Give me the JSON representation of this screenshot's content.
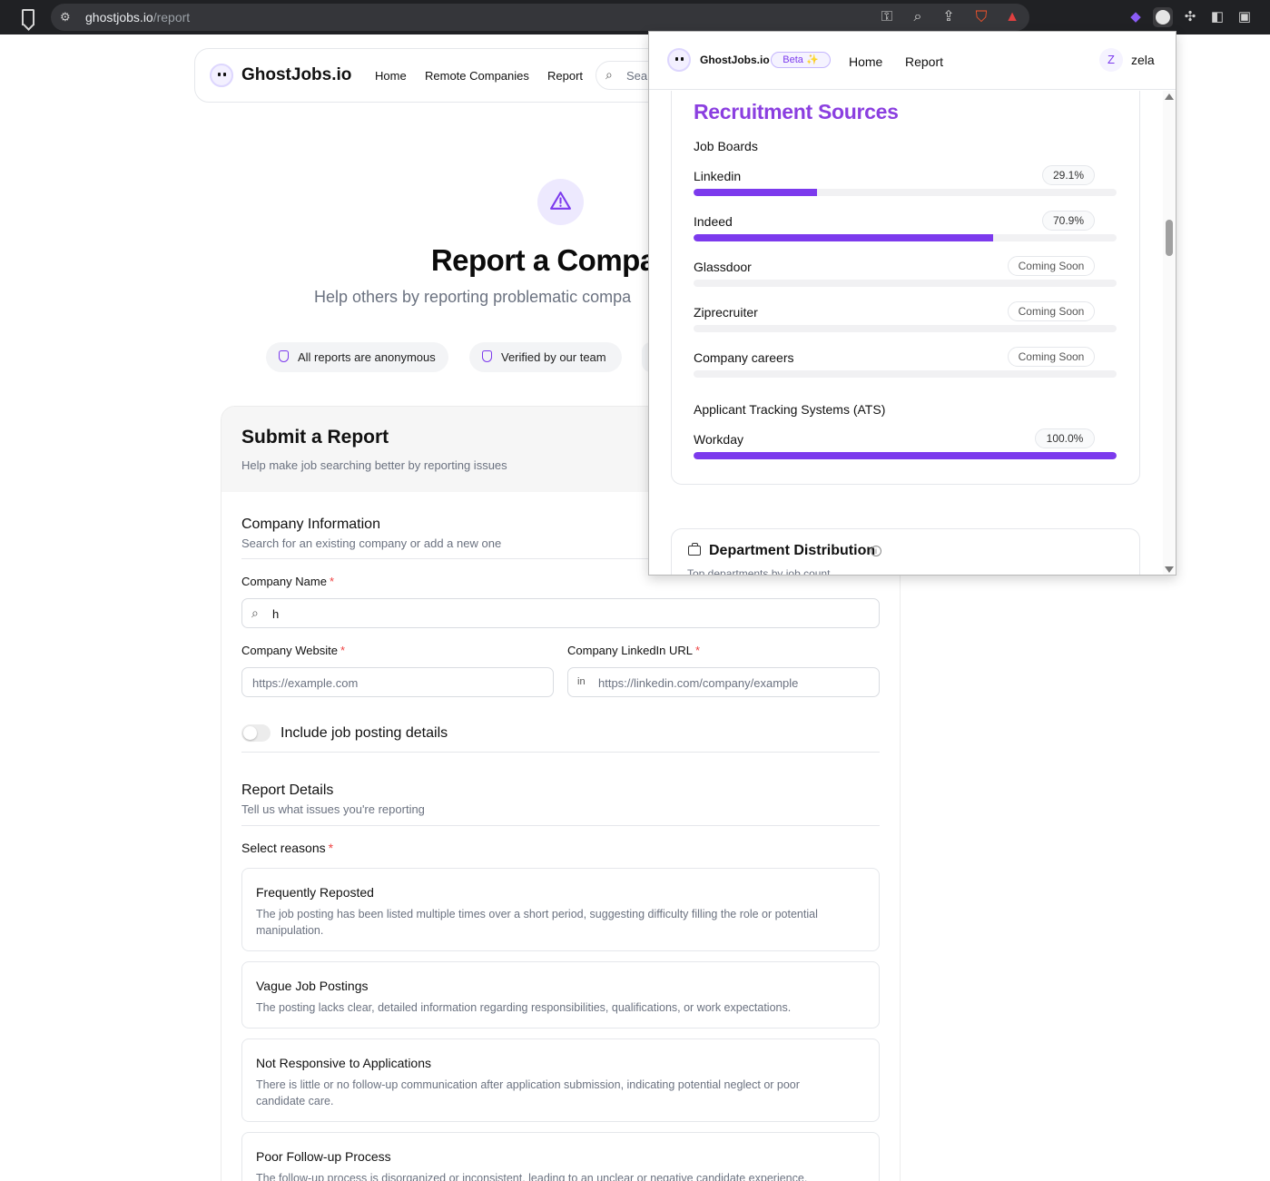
{
  "browser": {
    "url_host": "ghostjobs.io",
    "url_path": "/report",
    "icons": [
      "bookmark-icon",
      "site-settings-icon",
      "password-key-icon",
      "zoom-icon",
      "share-icon",
      "brave-shields-icon",
      "brave-rewards-icon",
      "extension-purple-icon",
      "ghostjobs-extension-icon",
      "extensions-puzzle-icon",
      "sidebar-icon",
      "wallet-icon"
    ]
  },
  "nav": {
    "brand": "GhostJobs.io",
    "links": [
      "Home",
      "Remote Companies",
      "Report"
    ],
    "search_placeholder": "Sear"
  },
  "hero": {
    "title": "Report a Company",
    "subtitle": "Help others by reporting problematic compa",
    "pills": [
      "All reports are anonymous",
      "Verified by our team"
    ]
  },
  "form": {
    "title": "Submit a Report",
    "subtitle": "Help make job searching better by reporting issues",
    "company_section": {
      "title": "Company Information",
      "subtitle": "Search for an existing company or add a new one"
    },
    "company_name": {
      "label": "Company Name",
      "required": "*",
      "value": "h"
    },
    "website": {
      "label": "Company Website",
      "required": "*",
      "placeholder": "https://example.com"
    },
    "linkedin": {
      "label": "Company LinkedIn URL",
      "required": "*",
      "placeholder": "https://linkedin.com/company/example"
    },
    "toggle_label": "Include job posting details",
    "report_section": {
      "title": "Report Details",
      "subtitle": "Tell us what issues you're reporting"
    },
    "reasons_label": "Select reasons",
    "reasons_required": "*",
    "reasons": [
      {
        "title": "Frequently Reposted",
        "desc": "The job posting has been listed multiple times over a short period, suggesting difficulty filling the role or potential manipulation."
      },
      {
        "title": "Vague Job Postings",
        "desc": "The posting lacks clear, detailed information regarding responsibilities, qualifications, or work expectations."
      },
      {
        "title": "Not Responsive to Applications",
        "desc": "There is little or no follow-up communication after application submission, indicating potential neglect or poor candidate care."
      },
      {
        "title": "Poor Follow-up Process",
        "desc": "The follow-up process is disorganized or inconsistent, leading to an unclear or negative candidate experience."
      }
    ]
  },
  "popup": {
    "brand": "GhostJobs.io",
    "beta": "Beta ✨",
    "links": [
      "Home",
      "Report"
    ],
    "avatar": "Z",
    "user": "zela",
    "recruitment": {
      "title": "Recruitment Sources",
      "job_boards_title": "Job Boards",
      "sources": [
        {
          "name": "Linkedin",
          "badge": "29.1%",
          "percent": 29.1
        },
        {
          "name": "Indeed",
          "badge": "70.9%",
          "percent": 70.9
        },
        {
          "name": "Glassdoor",
          "badge": "Coming Soon",
          "percent": 0
        },
        {
          "name": "Ziprecruiter",
          "badge": "Coming Soon",
          "percent": 0
        },
        {
          "name": "Company careers",
          "badge": "Coming Soon",
          "percent": 0
        }
      ],
      "ats_title": "Applicant Tracking Systems (ATS)",
      "ats": [
        {
          "name": "Workday",
          "badge": "100.0%",
          "percent": 100
        }
      ]
    },
    "department": {
      "title": "Department Distribution",
      "info": "i",
      "subtitle": "Top departments by job count"
    }
  },
  "colors": {
    "accent": "#7c3aed",
    "accent_title": "#8b3fe0",
    "required": "#ef4444"
  }
}
